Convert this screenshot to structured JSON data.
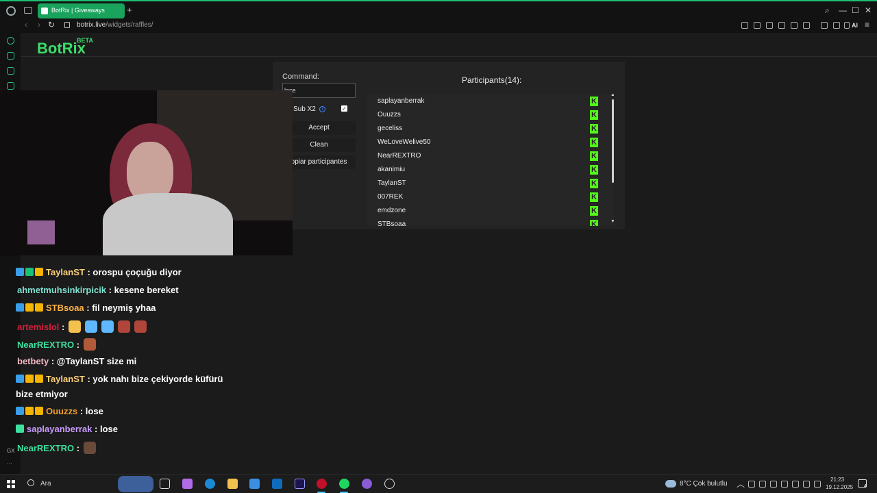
{
  "browser": {
    "tab_title": "BotRix | Giveaways",
    "url_host": "botrix.live",
    "url_path": "/widgets/raffles/",
    "ai_label": "AI"
  },
  "sidebar": {
    "bottom_label": "GX"
  },
  "app": {
    "brand": "BotRix",
    "brand_badge": "BETA"
  },
  "raffle": {
    "command_label": "Command:",
    "command_value": "lose",
    "sub_label": "Sub X2",
    "sub_checked": true,
    "accept_label": "Accept",
    "clean_label": "Clean",
    "copy_label": "opiar participantes",
    "participants_title": "Participants(14):",
    "participants": [
      "saplayanberrak",
      "Ouuzzs",
      "geceliss",
      "WeLoveWelive50",
      "NearREXTRO",
      "akanimiu",
      "TaylanST",
      "007REK",
      "emdzone",
      "STBsoaa"
    ],
    "platform_icon": "kick-icon",
    "platform_color": "#53fc18"
  },
  "chat": {
    "messages": [
      {
        "user": "TaylanST",
        "user_color": "#ffd27a",
        "text": ": orospu çoçuğu diyor"
      },
      {
        "user": "ahmetmuhsinkirpicik",
        "user_color": "#7fe0d0",
        "text": ": kesene bereket"
      },
      {
        "user": "STBsoaa",
        "user_color": "#ffb347",
        "text": ": fil neymiş yhaa"
      },
      {
        "user": "artemislol",
        "user_color": "#d21f3c",
        "text": ":"
      },
      {
        "user": "NearREXTRO",
        "user_color": "#3ee0a0",
        "text": ":"
      },
      {
        "user": "betbety",
        "user_color": "#f4b8c4",
        "text": ": @TaylanST size mi"
      },
      {
        "user": "TaylanST",
        "user_color": "#ffd27a",
        "text": ": yok nahı bize çekiyorde küfürü"
      },
      {
        "user": "",
        "user_color": "#ffffff",
        "text": "bize etmiyor"
      },
      {
        "user": "Ouuzzs",
        "user_color": "#f0a030",
        "text": ": lose"
      },
      {
        "user": "saplayanberrak",
        "user_color": "#c89bff",
        "text": ": lose"
      },
      {
        "user": "NearREXTRO",
        "user_color": "#3ee0a0",
        "text": ":"
      }
    ]
  },
  "taskbar": {
    "search_placeholder": "Ara",
    "weather": "8°C  Çok bulutlu",
    "time": "21:23",
    "date": "19.12.2025",
    "notification_count": "4"
  }
}
